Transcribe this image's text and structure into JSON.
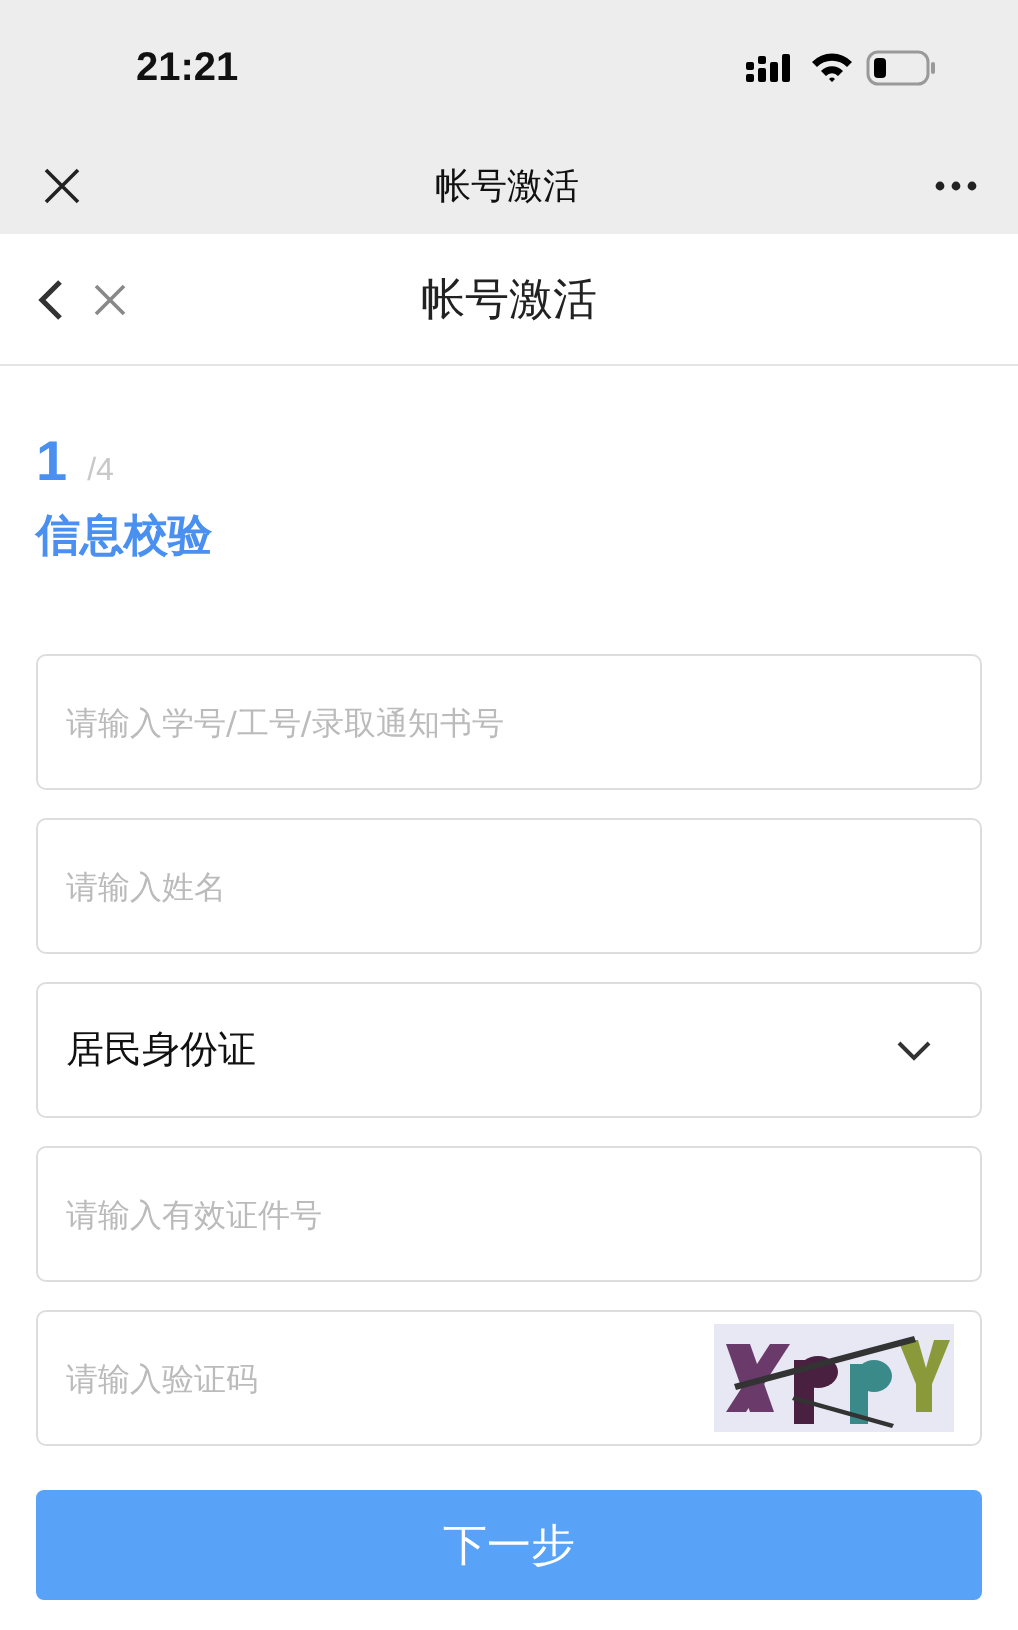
{
  "status_bar": {
    "time": "21:21"
  },
  "browser_bar": {
    "title": "帐号激活"
  },
  "page_header": {
    "title": "帐号激活"
  },
  "step": {
    "current": "1",
    "total": "/4",
    "title": "信息校验"
  },
  "fields": [
    {
      "kind": "input",
      "placeholder": "请输入学号/工号/录取通知书号"
    },
    {
      "kind": "input",
      "placeholder": "请输入姓名"
    },
    {
      "kind": "select",
      "value": "居民身份证"
    },
    {
      "kind": "input",
      "placeholder": "请输入有效证件号"
    },
    {
      "kind": "captcha",
      "placeholder": "请输入验证码"
    }
  ],
  "next_button": {
    "label": "下一步"
  }
}
